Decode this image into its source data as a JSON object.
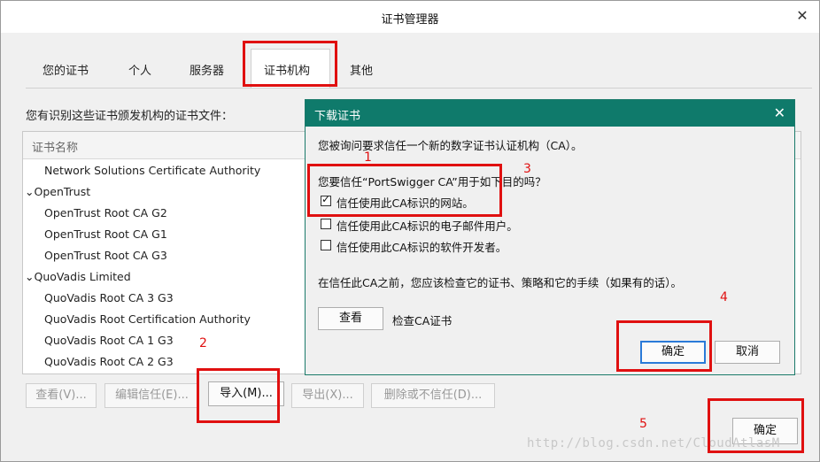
{
  "window": {
    "title": "证书管理器",
    "close_glyph": "✕"
  },
  "tabs": [
    {
      "label": "您的证书"
    },
    {
      "label": "个人"
    },
    {
      "label": "服务器"
    },
    {
      "label": "证书机构"
    },
    {
      "label": "其他"
    }
  ],
  "description": "您有识别这些证书颁发机构的证书文件：",
  "tree": {
    "column_header": "证书名称",
    "rows": [
      {
        "label": "Network Solutions Certificate Authority",
        "type": "cert"
      },
      {
        "label": "OpenTrust",
        "type": "group",
        "prefix": "⌄"
      },
      {
        "label": "OpenTrust Root CA G2",
        "type": "cert"
      },
      {
        "label": "OpenTrust Root CA G1",
        "type": "cert"
      },
      {
        "label": "OpenTrust Root CA G3",
        "type": "cert"
      },
      {
        "label": "QuoVadis Limited",
        "type": "group",
        "prefix": "⌄"
      },
      {
        "label": "QuoVadis Root CA 3 G3",
        "type": "cert"
      },
      {
        "label": "QuoVadis Root Certification Authority",
        "type": "cert"
      },
      {
        "label": "QuoVadis Root CA 1 G3",
        "type": "cert"
      },
      {
        "label": "QuoVadis Root CA 2 G3",
        "type": "cert"
      }
    ]
  },
  "buttons": {
    "view": "查看(V)...",
    "edit_trust": "编辑信任(E)...",
    "import": "导入(M)...",
    "export": "导出(X)...",
    "delete": "删除或不信任(D)...",
    "ok": "确定"
  },
  "dialog": {
    "title": "下载证书",
    "close_glyph": "✕",
    "intro": "您被询问要求信任一个新的数字证书认证机构（CA）。",
    "question": "您要信任“PortSwigger CA”用于如下目的吗？",
    "options": [
      {
        "label": "信任使用此CA标识的网站。",
        "checked": true
      },
      {
        "label": "信任使用此CA标识的电子邮件用户。",
        "checked": false
      },
      {
        "label": "信任使用此CA标识的软件开发者。",
        "checked": false
      }
    ],
    "notice": "在信任此CA之前，您应该检查它的证书、策略和它的手续（如果有的话）。",
    "view_button": "查看",
    "view_hint": "检查CA证书",
    "ok_button": "确定",
    "cancel_button": "取消"
  },
  "annotations": {
    "n1": "1",
    "n2": "2",
    "n3": "3",
    "n4": "4",
    "n5": "5",
    "color": "#e01010"
  },
  "watermark": "http://blog.csdn.net/CloudAtlasM"
}
